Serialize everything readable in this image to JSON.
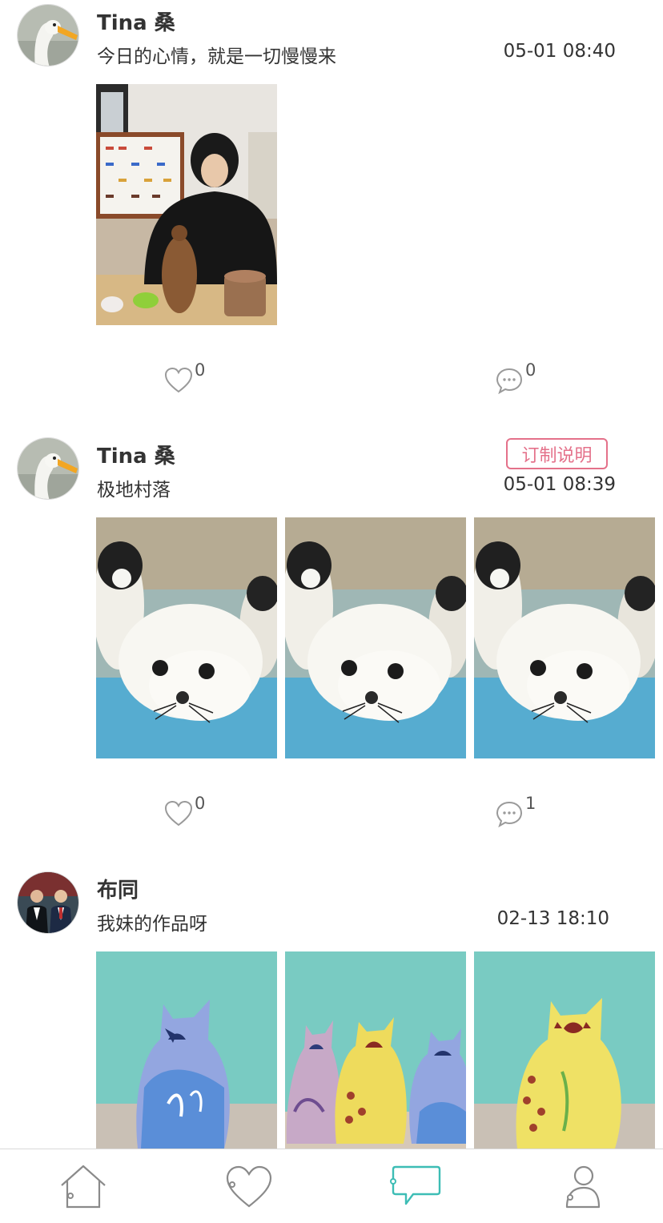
{
  "posts": [
    {
      "username": "Tina 桑",
      "text": "今日的心情，就是一切慢慢来",
      "time": "05-01 08:40",
      "likes": "0",
      "comments": "0",
      "tag": null,
      "avatar": "goose-avatar",
      "photos": [
        "artist-with-felted-otter-photo"
      ]
    },
    {
      "username": "Tina 桑",
      "text": "极地村落",
      "time": "05-01 08:39",
      "likes": "0",
      "comments": "1",
      "tag": "订制说明",
      "avatar": "goose-avatar",
      "photos": [
        "felted-seal-photo",
        "felted-seal-photo",
        "felted-seal-photo"
      ]
    },
    {
      "username": "布同",
      "text": "我妹的作品呀",
      "time": "02-13 18:10",
      "likes": null,
      "comments": null,
      "tag": null,
      "avatar": "people-avatar",
      "photos": [
        "blue-ceramic-cat-photo",
        "ceramic-cats-group-photo",
        "yellow-ceramic-cat-photo"
      ]
    }
  ],
  "tabbar": {
    "items": [
      {
        "name": "home",
        "icon": "home-icon",
        "active": false
      },
      {
        "name": "favorites",
        "icon": "heart-icon",
        "active": false
      },
      {
        "name": "messages",
        "icon": "chat-icon",
        "active": true
      },
      {
        "name": "profile",
        "icon": "person-icon",
        "active": false
      }
    ]
  },
  "colors": {
    "tag": "#e4718a",
    "active_tab": "#3dbdb5",
    "inactive_tab": "#888888",
    "icon": "#9a9a9a"
  }
}
